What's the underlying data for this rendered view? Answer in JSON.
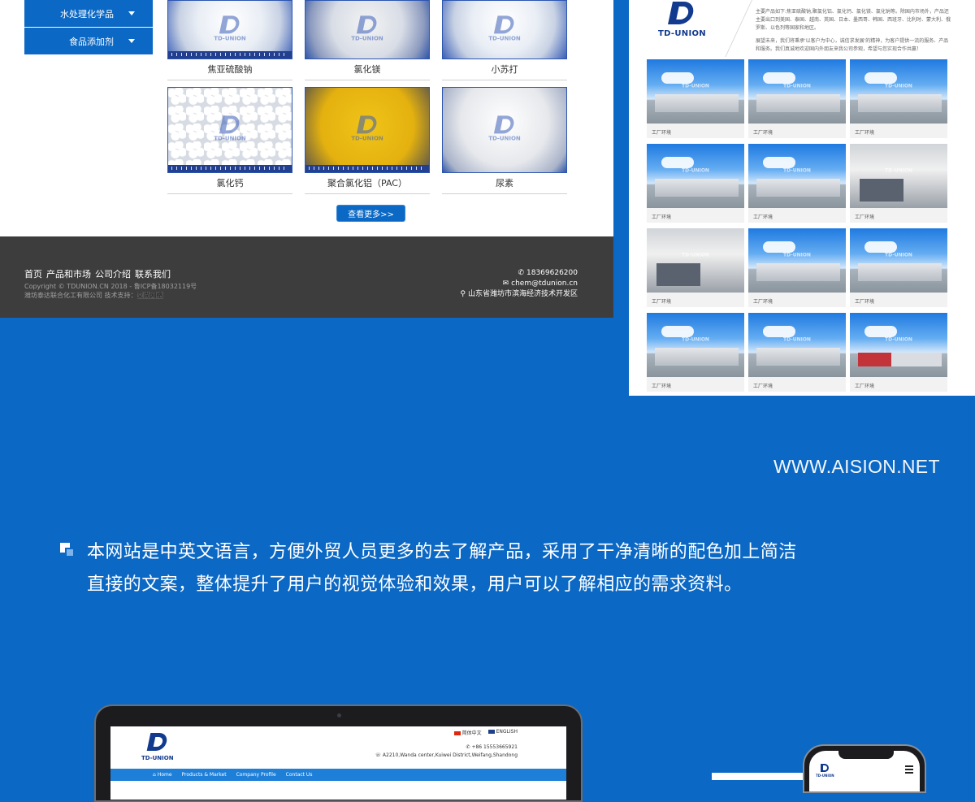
{
  "left_page": {
    "side_menu": [
      {
        "label": "水处理化学品"
      },
      {
        "label": "食品添加剂"
      }
    ],
    "products": [
      {
        "name": "焦亚硫酸钠",
        "image": "white-powder"
      },
      {
        "name": "氯化镁",
        "image": "white-flakes"
      },
      {
        "name": "小苏打",
        "image": "white-powder"
      },
      {
        "name": "氯化钙",
        "image": "white-pellets"
      },
      {
        "name": "聚合氯化铝（PAC）",
        "image": "yellow-powder"
      },
      {
        "name": "尿素",
        "image": "white-granules"
      }
    ],
    "product_watermark": "TD-UNION",
    "more_button": "查看更多>>",
    "footer": {
      "nav": [
        "首页",
        "产品和市场",
        "公司介绍",
        "联系我们"
      ],
      "copyright_line": "Copyright © TDUNION.CN 2018 - 鲁ICP备18032119号",
      "company_line": "潍坊泰达联合化工有限公司",
      "support_label": "技术支持：",
      "support_value": "艾尚网络",
      "phone": "18369626200",
      "email": "chem@tdunion.cn",
      "address": "山东省潍坊市滨海经济技术开发区",
      "phone_icon": "phone-icon",
      "email_icon": "envelope-icon",
      "address_icon": "location-pin-icon"
    }
  },
  "right_page": {
    "logo_text": "TD-UNION",
    "intro": [
      "主要产品如下:焦亚硫酸钠,聚氯化铝、氯化钙、氯化镁、氯化钠等。除国内市场外，产品还主要出口到美国、泰国、越南、英国、日本、墨西哥、韩国、西班牙、比利时、蒙大利、俄罗斯、以色列等国家和地区。",
      "展望未来，我们将秉承'以客户为中心，诚信求发展'的精神，为客户提供一流的服务、产品和服务。我们真诚地欢迎国内外朋友来我公司参观，希望与您实现合作共赢！"
    ],
    "environment_caption": "工厂环境",
    "environment_photos": [
      {
        "scene": "building"
      },
      {
        "scene": "building"
      },
      {
        "scene": "building"
      },
      {
        "scene": "building"
      },
      {
        "scene": "building"
      },
      {
        "scene": "indoor"
      },
      {
        "scene": "indoor"
      },
      {
        "scene": "building"
      },
      {
        "scene": "building"
      },
      {
        "scene": "building"
      },
      {
        "scene": "building"
      },
      {
        "scene": "truck"
      }
    ],
    "photo_watermark": "TD-UNION"
  },
  "site_url": "WWW.AISION.NET",
  "description": "本网站是中英文语言，方便外贸人员更多的去了解产品，采用了干净清晰的配色加上简洁直接的文案，整体提升了用户的视觉体验和效果，用户可以了解相应的需求资料。",
  "laptop_page": {
    "logo_text": "TD-UNION",
    "lang_cn": "简体中文",
    "lang_en": "ENGLISH",
    "phone": "+86 15553665921",
    "address": "A2210,Wanda center,Kuiwei District,Weifang,Shandong",
    "nav": [
      "Home",
      "Products & Market",
      "Company Profile",
      "Contact Us"
    ]
  },
  "phone_page": {
    "logo_text": "TD-UNION"
  },
  "colors": {
    "brand_blue": "#0b68c4",
    "footer_gray": "#3d3d3d",
    "logo_navy": "#123a8e"
  }
}
